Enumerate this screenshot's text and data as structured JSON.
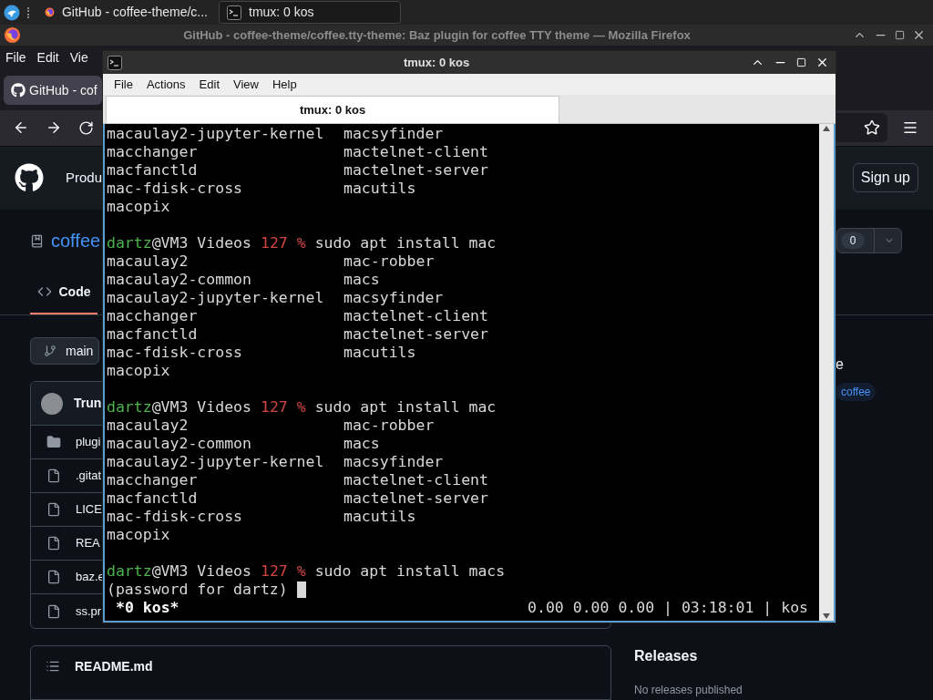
{
  "taskbar": {
    "tasks": [
      {
        "kind": "browser",
        "title": "GitHub - coffee-theme/c...",
        "selected": false
      },
      {
        "kind": "terminal",
        "title": "tmux: 0 kos",
        "selected": true
      }
    ]
  },
  "browser": {
    "title": "GitHub - coffee-theme/coffee.tty-theme: Baz plugin for coffee TTY theme — Mozilla Firefox",
    "menu": [
      "File",
      "Edit",
      "Vie"
    ],
    "tab": {
      "title": "GitHub - cof"
    },
    "page": {
      "nav_item": "Produ",
      "sign_up": "Sign up",
      "repo_name": "coffee",
      "star_count": "0",
      "tabs": [
        {
          "label": "Code",
          "selected": true
        }
      ],
      "branch": "main",
      "commit_author": "Trun",
      "files": [
        {
          "kind": "folder",
          "name": "plugi"
        },
        {
          "kind": "file",
          "name": ".gitat"
        },
        {
          "kind": "file",
          "name": "LICE"
        },
        {
          "kind": "file",
          "name": "REA"
        },
        {
          "kind": "file",
          "name": "baz.e"
        },
        {
          "kind": "file",
          "name": "ss.pr"
        }
      ],
      "readme": "README.md",
      "about_fragment": "e",
      "topics": [
        "coffee"
      ],
      "releases": {
        "title": "Releases",
        "note": "No releases published"
      }
    }
  },
  "terminal": {
    "title": "tmux: 0 kos",
    "menu": [
      "File",
      "Actions",
      "Edit",
      "View",
      "Help"
    ],
    "tabs": [
      {
        "label": "tmux: 0 kos",
        "selected": true
      }
    ],
    "lines": [
      {
        "kind": "columns",
        "cells": [
          "macaulay2-jupyter-kernel",
          "macsyfinder"
        ]
      },
      {
        "kind": "columns",
        "cells": [
          "macchanger",
          "mactelnet-client"
        ]
      },
      {
        "kind": "columns",
        "cells": [
          "macfanctld",
          "mactelnet-server"
        ]
      },
      {
        "kind": "columns",
        "cells": [
          "mac-fdisk-cross",
          "macutils"
        ]
      },
      {
        "kind": "text",
        "text": "macopix"
      },
      {
        "kind": "blank"
      },
      {
        "kind": "prompt",
        "user": "dartz",
        "location": "@VM3 Videos",
        "status": "127 %",
        "command": "sudo apt install mac"
      },
      {
        "kind": "columns",
        "cells": [
          "macaulay2",
          "mac-robber"
        ]
      },
      {
        "kind": "columns",
        "cells": [
          "macaulay2-common",
          "macs"
        ]
      },
      {
        "kind": "columns",
        "cells": [
          "macaulay2-jupyter-kernel",
          "macsyfinder"
        ]
      },
      {
        "kind": "columns",
        "cells": [
          "macchanger",
          "mactelnet-client"
        ]
      },
      {
        "kind": "columns",
        "cells": [
          "macfanctld",
          "mactelnet-server"
        ]
      },
      {
        "kind": "columns",
        "cells": [
          "mac-fdisk-cross",
          "macutils"
        ]
      },
      {
        "kind": "text",
        "text": "macopix"
      },
      {
        "kind": "blank"
      },
      {
        "kind": "prompt",
        "user": "dartz",
        "location": "@VM3 Videos",
        "status": "127 %",
        "command": "sudo apt install mac"
      },
      {
        "kind": "columns",
        "cells": [
          "macaulay2",
          "mac-robber"
        ]
      },
      {
        "kind": "columns",
        "cells": [
          "macaulay2-common",
          "macs"
        ]
      },
      {
        "kind": "columns",
        "cells": [
          "macaulay2-jupyter-kernel",
          "macsyfinder"
        ]
      },
      {
        "kind": "columns",
        "cells": [
          "macchanger",
          "mactelnet-client"
        ]
      },
      {
        "kind": "columns",
        "cells": [
          "macfanctld",
          "mactelnet-server"
        ]
      },
      {
        "kind": "columns",
        "cells": [
          "mac-fdisk-cross",
          "macutils"
        ]
      },
      {
        "kind": "text",
        "text": "macopix"
      },
      {
        "kind": "blank"
      },
      {
        "kind": "prompt",
        "user": "dartz",
        "location": "@VM3 Videos",
        "status": "127 %",
        "command": "sudo apt install macs"
      },
      {
        "kind": "input",
        "text": "(password for dartz)"
      }
    ],
    "status": {
      "window": "*0 kos*",
      "info": "0.00 0.00 0.00 | 03:18:01 | kos"
    }
  }
}
